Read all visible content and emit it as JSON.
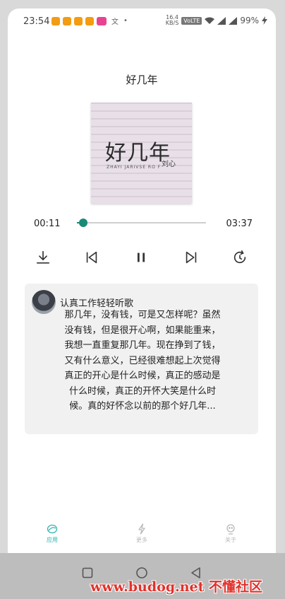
{
  "status_bar": {
    "time": "23:54",
    "net_speed_value": "16.4",
    "net_speed_unit": "KB/S",
    "volte": "VoLTE",
    "battery": "99%"
  },
  "player": {
    "song_title": "好几年",
    "cover": {
      "title": "好几年",
      "subtitle": "ZHAYI  JARIVSE  RO F",
      "artist": "刘心"
    },
    "elapsed": "00:11",
    "total": "03:37",
    "progress": 0.05
  },
  "controls": [
    "download-icon",
    "previous-icon",
    "pause-icon",
    "next-icon",
    "repeat-icon"
  ],
  "card": {
    "username": "认真工作轻轻听歌",
    "text": "那几年，没有钱，可是又怎样呢？虽然没有钱，但是很开心啊，如果能重来，我想一直重复那几年。现在挣到了钱，又有什么意义，已经很难想起上次觉得真正的开心是什么时候，真正的感动是什么时候，真正的开怀大笑是什么时候。真的好怀念以前的那个好几年..."
  },
  "bottom_nav": {
    "items": [
      {
        "label": "应用",
        "icon": "app-icon",
        "active": true
      },
      {
        "label": "更多",
        "icon": "lightning-icon",
        "active": false
      },
      {
        "label": "关于",
        "icon": "about-icon",
        "active": false
      }
    ]
  },
  "watermark": "www.budog.net 不懂社区",
  "colors": {
    "accent": "#1a8a78",
    "nav_active": "#33b3b0",
    "watermark": "#e0312b"
  }
}
